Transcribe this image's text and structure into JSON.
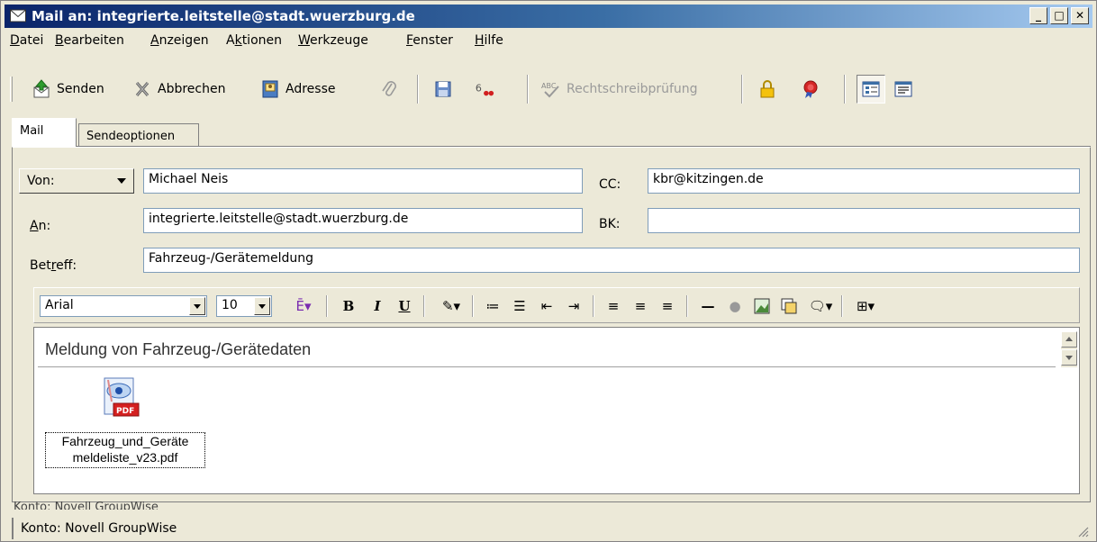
{
  "window": {
    "title": "Mail an: integrierte.leitstelle@stadt.wuerzburg.de"
  },
  "menu": [
    {
      "label": "Datei",
      "ul": "D"
    },
    {
      "label": "Bearbeiten",
      "ul": "B"
    },
    {
      "label": "Anzeigen",
      "ul": "A"
    },
    {
      "label": "Aktionen",
      "ul": "k"
    },
    {
      "label": "Werkzeuge",
      "ul": "W"
    },
    {
      "label": "Fenster",
      "ul": "F"
    },
    {
      "label": "Hilfe",
      "ul": "H"
    }
  ],
  "toolbar": {
    "send_label": "Senden",
    "cancel_label": "Abbrechen",
    "address_label": "Adresse",
    "spellcheck_label": "Rechtschreibprüfung"
  },
  "tabs": {
    "mail": "Mail",
    "send_options": "Sendeoptionen"
  },
  "form": {
    "from_label": "Von:",
    "from_value": "Michael Neis",
    "to_label": "An:",
    "to_value": "integrierte.leitstelle@stadt.wuerzburg.de",
    "subject_label": "Betreff:",
    "subject_value": "Fahrzeug-/Gerätemeldung",
    "cc_label": "CC:",
    "cc_value": "kbr@kitzingen.de",
    "bcc_label": "BK:",
    "bcc_value": ""
  },
  "format": {
    "font": "Arial",
    "size": "10"
  },
  "editor": {
    "body_text": "Meldung von Fahrzeug-/Gerätedaten",
    "attachment_line1": "Fahrzeug_und_Geräte",
    "attachment_line2": "meldeliste_v23.pdf"
  },
  "status": {
    "clipped_text": "Konto: Novell GroupWise",
    "text": "Konto: Novell GroupWise"
  },
  "colors": {
    "titlebar_start": "#0a246a",
    "titlebar_end": "#a6caf0",
    "chrome": "#ece9d8"
  }
}
